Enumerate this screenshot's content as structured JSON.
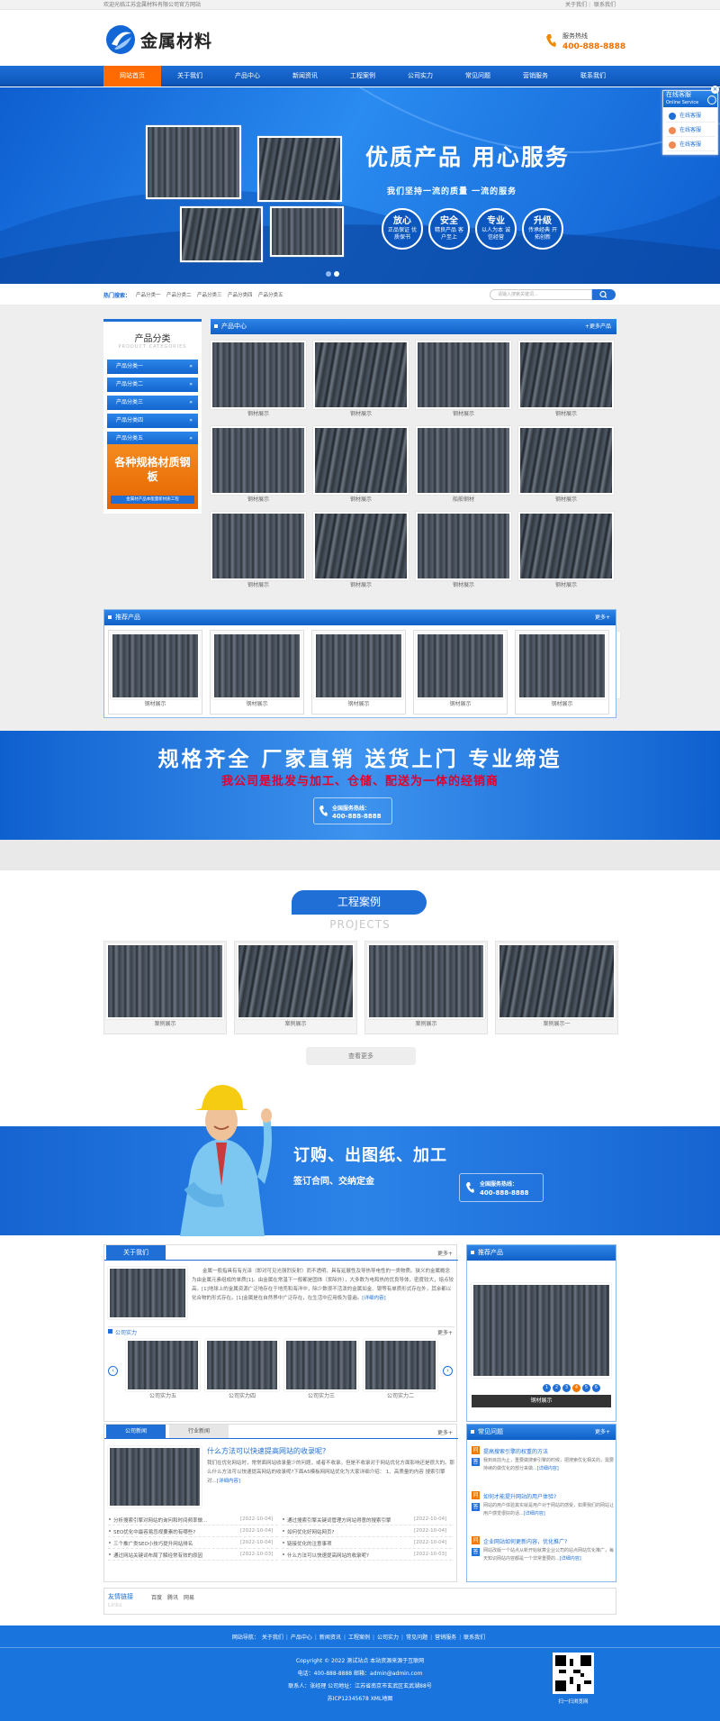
{
  "topbar": {
    "welcome": "欢迎光临江苏金属材料有限公司官方网站",
    "about": "关于我们",
    "contact": "联系我们",
    "sep": "|"
  },
  "header": {
    "logo_text": "金属材料",
    "hotline_label": "服务热线",
    "hotline": "400-888-8888"
  },
  "nav": {
    "items": [
      "网站首页",
      "关于我们",
      "产品中心",
      "新闻资讯",
      "工程案例",
      "公司实力",
      "常见问题",
      "营销服务",
      "联系我们"
    ]
  },
  "banner": {
    "headline": "优质产品 用心服务",
    "sub": "我们坚持一流的质量 一流的服务",
    "badges": [
      {
        "t": "放心",
        "d": "正品保证 优质保书"
      },
      {
        "t": "安全",
        "d": "精良产品 客户至上"
      },
      {
        "t": "专业",
        "d": "以人为本 诚信经营"
      },
      {
        "t": "升级",
        "d": "传承经典 开拓创新"
      }
    ]
  },
  "online": {
    "title": "在线客服",
    "subtitle": "Online Service",
    "links": [
      "在线客服",
      "在线客服",
      "在线客服"
    ],
    "close": "×"
  },
  "hot": {
    "label": "热门搜索：",
    "items": [
      "产品分类一",
      "产品分类二",
      "产品分类三",
      "产品分类四",
      "产品分类五"
    ],
    "placeholder": "请输入搜索关键词..."
  },
  "categories": {
    "title": "产品分类",
    "subtitle": "PRODUCT CATEGORIES",
    "items": [
      "产品分类一",
      "产品分类二",
      "产品分类三",
      "产品分类四",
      "产品分类五"
    ],
    "promo_title": "各种规格材质钢板",
    "promo_bar": "金属材产品本能量新材质工程"
  },
  "products": {
    "title": "产品中心",
    "more": "+更多产品",
    "items": [
      "钢材展示",
      "钢材展示",
      "钢材展示",
      "钢材展示",
      "钢材展示",
      "钢材展示",
      "船舶钢材",
      "钢材展示",
      "钢材展示",
      "钢材展示",
      "钢材展示",
      "钢材展示"
    ]
  },
  "recommend": {
    "title": "推荐产品",
    "more": "更多+",
    "items": [
      "钢材展示",
      "钢材展示",
      "钢材展示",
      "钢材展示",
      "钢材展示"
    ]
  },
  "slogan": {
    "line1": "规格齐全  厂家直销  送货上门  专业缔造",
    "line2": "我公司是批发与加工、仓储、配送为一体的经销商",
    "hotline_label": "全国服务热线：",
    "hotline": "400-888-8888"
  },
  "cases": {
    "title": "工程案例",
    "subtitle": "PROJECTS",
    "items": [
      "案例展示",
      "案例展示",
      "案例展示",
      "案例展示一"
    ],
    "more": "查看更多"
  },
  "order": {
    "line1": "订购、出图纸、加工",
    "line2": "签订合同、交纳定金",
    "hotline_label": "全国服务热线：",
    "hotline": "400-888-8888"
  },
  "about": {
    "title": "关于我们",
    "more": "更多+",
    "text": "金属一般指具有有光泽（即对可见光强烈反射）而不透明、具有延展性及导热导电性的一类物质。狭义的金属概念为由金属元素组成的单质[1]。由金属在常温下一般都是固体（汞除外），大多数为电和热的优良导体，密度较大，熔点较高。[1]地球上的金属资源广泛地存在于地壳和海洋中，除少数很不活泼的金属如金、银等有单质形式存在外，其余都以化合物的形式存在。[1]金属是在自然界中广泛存在，在生活中应用极为普遍。",
    "detail": "[详细内容]"
  },
  "strength": {
    "title": "公司实力",
    "more": "更多+",
    "items": [
      "公司实力五",
      "公司实力四",
      "公司实力三",
      "公司实力二"
    ]
  },
  "side_rec": {
    "title": "推荐产品",
    "caption": "钢材展示",
    "pages": [
      "1",
      "2",
      "3",
      "4",
      "5",
      "6"
    ]
  },
  "news": {
    "tabs": [
      "公司新闻",
      "行业新闻"
    ],
    "more": "更多+",
    "headline": "什么方法可以快速提高网站的收录呢?",
    "summary": "我们在优化网站时，常常面网站收录量少的问题，或者不收录。但是不收录对于网站优化方面影响还是很大的。那么什么方法可以快速提高网站的收录呢?下面A5模板网网站优化为大家详细介绍：    1、高质量的内容    搜索引擎对...",
    "detail": "[详细内容]",
    "left": [
      {
        "t": "分析搜索引擎对网站的询问和时间频率做...",
        "d": "[2022-10-04]"
      },
      {
        "t": "SEO优化中最容易忽视要素的有哪些?",
        "d": "[2022-10-04]"
      },
      {
        "t": "三个推广类SEO小技巧提升网站排名",
        "d": "[2022-10-04]"
      },
      {
        "t": "通过网站关键词布局了解经常有效的原因",
        "d": "[2022-10-03]"
      }
    ],
    "right": [
      {
        "t": "通过搜索引擎关键词管理方网站得意的搜索引擎",
        "d": "[2022-10-04]"
      },
      {
        "t": "如何优化好网站网页?",
        "d": "[2022-10-04]"
      },
      {
        "t": "链接优化的注意事项",
        "d": "[2022-10-04]"
      },
      {
        "t": "什么方法可以快速提高网站的收录呢?",
        "d": "[2022-10-03]"
      }
    ]
  },
  "faq": {
    "title": "常见问题",
    "more": "更多+",
    "items": [
      {
        "q": "提高搜索引擎的权重的方法",
        "a": "我到目前为止，重要做搜索引擎的时候，把搜索优化相关的，需要持续的做优化的部分来做..."
      },
      {
        "q": "如何才能提升网站的用户体验?",
        "a": "网站的用户体验其实就是用户对于网站的感受，如果我们的网站让用户感觉很好的话..."
      },
      {
        "q": "企业网站如何更新内容，优化推广?",
        "a": "网站改版一个站点从新开始就算企业公司的站点网站优化推广，每天知识网站内容都是一个非常重要的..."
      }
    ],
    "detail": "[详细内容]"
  },
  "links": {
    "title": "友情链接",
    "en": "Links",
    "items": [
      "百度",
      "腾讯",
      "网易"
    ]
  },
  "footer": {
    "nav_label": "网站导航：",
    "nav": [
      "关于我们",
      "产品中心",
      "新闻资讯",
      "工程案例",
      "公司实力",
      "常见问题",
      "营销服务",
      "联系我们"
    ],
    "copyright": "Copyright © 2022 测试站点 本站资源来源于互联网",
    "phone": "电话：400-888-8888    邮箱：admin@admin.com",
    "contact": "联系人：张经理    公司地址：江苏省南京市玄武区玄武湖88号",
    "icp": "苏ICP12345678    XML地图",
    "qr_label": "扫一扫浏览网"
  }
}
